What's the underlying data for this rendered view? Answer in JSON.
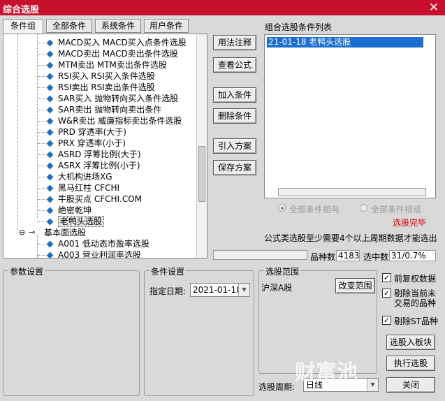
{
  "window": {
    "title": "综合选股"
  },
  "tabs": [
    {
      "label": "条件组"
    },
    {
      "label": "全部条件"
    },
    {
      "label": "系统条件"
    },
    {
      "label": "用户条件"
    }
  ],
  "tree": {
    "items": [
      {
        "label": "MACD买入 MACD买入点条件选股"
      },
      {
        "label": "MACD卖出 MACD卖出条件选股"
      },
      {
        "label": "MTM卖出 MTM卖出条件选股"
      },
      {
        "label": "RSI买入 RSI买入条件选股"
      },
      {
        "label": "RSI卖出 RSI卖出条件选股"
      },
      {
        "label": "SAR买入 抛物转向买入条件选股"
      },
      {
        "label": "SAR卖出 抛物转向卖出条件"
      },
      {
        "label": "W&R卖出 威廉指标卖出条件选股"
      },
      {
        "label": "PRD 穿透率(大于)"
      },
      {
        "label": "PRX 穿透率(小于)"
      },
      {
        "label": "ASRD 浮筹比例(大于)"
      },
      {
        "label": "ASRX 浮筹比例(小于)"
      },
      {
        "label": "大机构进场XG"
      },
      {
        "label": "黑马红柱 CFCHI"
      },
      {
        "label": "牛股买点 CFCHI.COM"
      },
      {
        "label": "绝密乾坤"
      },
      {
        "label": "老鸭头选股"
      }
    ],
    "group_label": "基本面选股",
    "sub_items": [
      {
        "label": "A001 低动态市盈率选股"
      },
      {
        "label": "A003 营业利润率选股"
      }
    ]
  },
  "buttons": {
    "usage": "用法注释",
    "view_formula": "查看公式",
    "add_condition": "加入条件",
    "delete_condition": "删除条件",
    "import_plan": "引入方案",
    "save_plan": "保存方案",
    "change_range": "改变范围",
    "select_to_block": "选股入板块",
    "execute": "执行选股",
    "close": "关闭"
  },
  "condition_list": {
    "title": "组合选股条件列表",
    "items": [
      "21-01-18 老鸭头选股"
    ]
  },
  "options": {
    "and_label": "全部条件相与",
    "or_label": "全部条件相或",
    "status": "选股完毕",
    "notice": "公式类选股至少需要4个以上周期数据才能选出"
  },
  "stats": {
    "count_label": "品种数",
    "count_value": "4183",
    "selected_label": "选中数",
    "selected_value": "31/0.7%"
  },
  "params": {
    "title": "参数设置"
  },
  "cond_settings": {
    "title": "条件设置",
    "date_label": "指定日期:",
    "date_value": "2021-01-18"
  },
  "range": {
    "title": "选股范围",
    "value": "沪深A股"
  },
  "checks": {
    "pre_adjust": "前复权数据",
    "exclude_unlisted_1": "剔除当前未",
    "exclude_unlisted_2": "交易的品种",
    "exclude_st": "剔除ST品种"
  },
  "period": {
    "label": "选股周期:",
    "value": "日线"
  },
  "watermark": {
    "text": "财富池"
  }
}
